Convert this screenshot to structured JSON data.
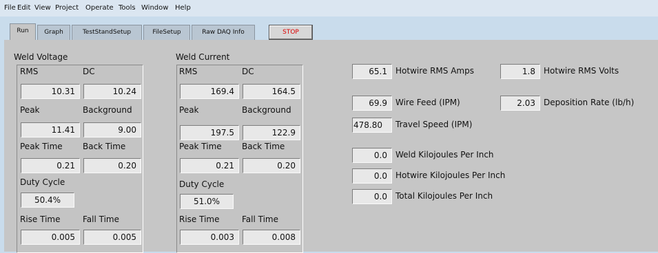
{
  "menu": [
    "File",
    "Edit",
    "View",
    "Project",
    "Operate",
    "Tools",
    "Window",
    "Help"
  ],
  "tabs": [
    "Run",
    "Graph",
    "TestStandSetup",
    "FileSetup",
    "Raw DAQ Info"
  ],
  "stop_label": "STOP",
  "weld_voltage": {
    "title": "Weld Voltage",
    "rms_label": "RMS",
    "rms": "10.31",
    "dc_label": "DC",
    "dc": "10.24",
    "peak_label": "Peak",
    "peak": "11.41",
    "background_label": "Background",
    "background": "9.00",
    "peak_time_label": "Peak Time",
    "peak_time": "0.21",
    "back_time_label": "Back Time",
    "back_time": "0.20",
    "duty_cycle_label": "Duty Cycle",
    "duty_cycle": "50.4%",
    "rise_time_label": "Rise Time",
    "rise_time": "0.005",
    "fall_time_label": "Fall Time",
    "fall_time": "0.005"
  },
  "weld_current": {
    "title": "Weld Current",
    "rms_label": "RMS",
    "rms": "169.4",
    "dc_label": "DC",
    "dc": "164.5",
    "peak_label": "Peak",
    "peak": "197.5",
    "background_label": "Background",
    "background": "122.9",
    "peak_time_label": "Peak Time",
    "peak_time": "0.21",
    "back_time_label": "Back Time",
    "back_time": "0.20",
    "duty_cycle_label": "Duty Cycle",
    "duty_cycle": "51.0%",
    "rise_time_label": "Rise Time",
    "rise_time": "0.003",
    "fall_time_label": "Fall Time",
    "fall_time": "0.008"
  },
  "readouts": {
    "hotwire_rms_amps": {
      "value": "65.1",
      "label": "Hotwire RMS Amps"
    },
    "hotwire_rms_volts": {
      "value": "1.8",
      "label": "Hotwire RMS Volts"
    },
    "wire_feed": {
      "value": "69.9",
      "label": "Wire Feed (IPM)"
    },
    "deposition_rate": {
      "value": "2.03",
      "label": "Deposition Rate (lb/h)"
    },
    "travel_speed": {
      "value": "478.80",
      "label": "Travel Speed (IPM)"
    },
    "weld_kj": {
      "value": "0.0",
      "label": "Weld Kilojoules Per Inch"
    },
    "hotwire_kj": {
      "value": "0.0",
      "label": "Hotwire Kilojoules Per Inch"
    },
    "total_kj": {
      "value": "0.0",
      "label": "Total Kilojoules Per Inch"
    }
  }
}
